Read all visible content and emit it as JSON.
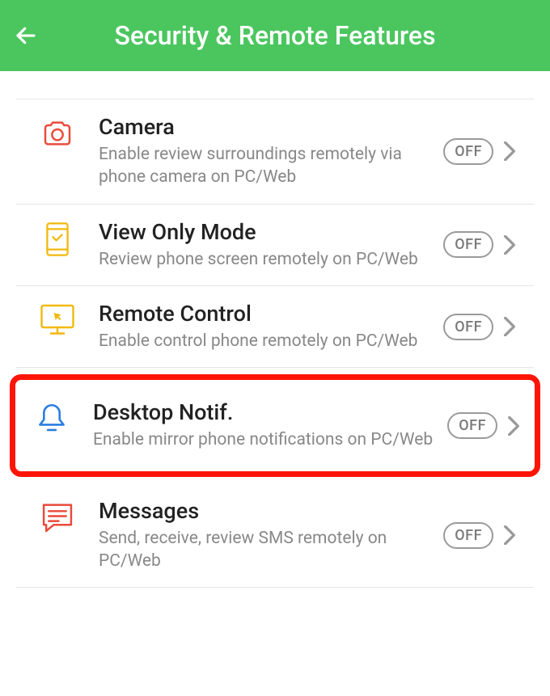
{
  "header": {
    "title": "Security & Remote Features"
  },
  "items": [
    {
      "title": "Camera",
      "desc": "Enable review surroundings remotely via phone camera on PC/Web",
      "state": "OFF"
    },
    {
      "title": "View Only Mode",
      "desc": "Review phone screen remotely on PC/Web",
      "state": "OFF"
    },
    {
      "title": "Remote Control",
      "desc": "Enable control phone remotely on PC/Web",
      "state": "OFF"
    },
    {
      "title": "Desktop Notif.",
      "desc": "Enable mirror phone notifications on PC/Web",
      "state": "OFF"
    },
    {
      "title": "Messages",
      "desc": "Send, receive, review SMS remotely on PC/Web",
      "state": "OFF"
    }
  ]
}
